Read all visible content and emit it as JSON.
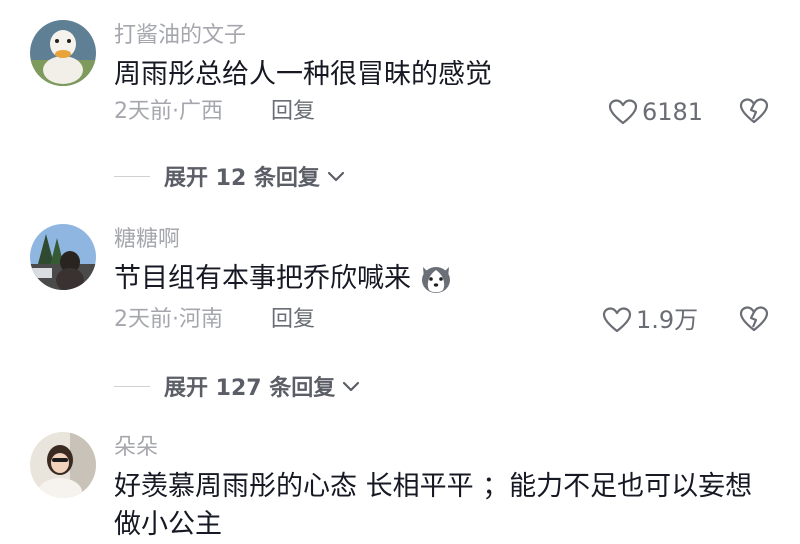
{
  "comments": [
    {
      "username": "打酱油的文子",
      "text": "周雨彤总给人一种很冒昧的感觉",
      "time": "2天前",
      "location": "广西",
      "reply_label": "回复",
      "likes": "6181",
      "expand_label": "展开 12 条回复"
    },
    {
      "username": "糖糖啊",
      "text": "节目组有本事把乔欣喊来",
      "emoji": "husky-dog-emoji",
      "time": "2天前",
      "location": "河南",
      "reply_label": "回复",
      "likes": "1.9万",
      "expand_label": "展开 127 条回复"
    },
    {
      "username": "朵朵",
      "text": "好羡慕周雨彤的心态 长相平平 ；能力不足也可以妄想做小公主"
    }
  ],
  "meta_separator": "·",
  "icons": {
    "like": "heart-outline-icon",
    "dislike": "broken-heart-icon",
    "expand": "chevron-down-icon"
  },
  "colors": {
    "text": "#161823",
    "secondary": "#a5a7ad",
    "action": "#6a6d74"
  }
}
